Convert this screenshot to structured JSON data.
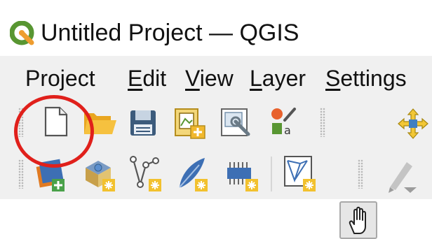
{
  "window": {
    "title": "Untitled Project — QGIS",
    "app_icon": "qgis-logo-icon"
  },
  "menubar": {
    "items": [
      {
        "label": "Project",
        "mnemonic": "j"
      },
      {
        "label": "Edit",
        "mnemonic": "E"
      },
      {
        "label": "View",
        "mnemonic": "V"
      },
      {
        "label": "Layer",
        "mnemonic": "L"
      },
      {
        "label": "Settings",
        "mnemonic": "S"
      }
    ]
  },
  "project_toolbar": {
    "buttons": [
      "new-project-icon",
      "open-project-icon",
      "save-project-icon",
      "new-print-layout-icon",
      "layout-manager-icon",
      "style-manager-icon"
    ]
  },
  "map_navigation_toolbar": {
    "buttons": [
      "pan-map-icon",
      "pan-to-selection-icon"
    ],
    "active": "pan-map-icon"
  },
  "data_source_toolbar": {
    "buttons": [
      "data-source-manager-icon",
      "new-geopackage-layer-icon",
      "new-shapefile-layer-icon",
      "new-spatialite-layer-icon",
      "new-virtual-layer-icon",
      "new-mesh-layer-icon",
      "digitize-pen-icon"
    ]
  },
  "annotation": {
    "highlight_color": "#e0201b",
    "highlighted": "new-project-icon"
  }
}
